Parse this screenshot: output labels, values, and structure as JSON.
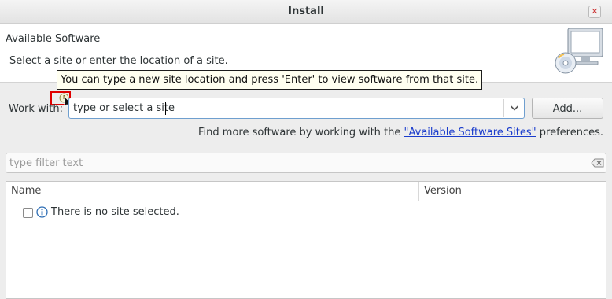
{
  "window": {
    "title": "Install",
    "close_glyph": "✕"
  },
  "header": {
    "title": "Available Software",
    "description": "Select a site or enter the location of a site.",
    "image_icon": "computer-cd-icon"
  },
  "tooltip": {
    "text": "You can type a new site location and press 'Enter' to view software from that site."
  },
  "work_with": {
    "label": "Work with:",
    "value": "type or select a site",
    "dropdown_icon": "chevron-down-icon",
    "add_label": "Add..."
  },
  "find_more": {
    "prefix": "Find more software by working with the ",
    "link": "\"Available Software Sites\"",
    "suffix": " preferences."
  },
  "filter": {
    "placeholder": "type filter text",
    "clear_icon": "clear-text-icon"
  },
  "table": {
    "columns": [
      "Name",
      "Version"
    ],
    "rows": [
      {
        "checked": false,
        "icon": "info-icon",
        "label": "There is no site selected."
      }
    ]
  },
  "colors": {
    "link": "#1a3ccc",
    "focus_border": "#6f9fcf",
    "highlight": "#e00000",
    "tooltip_bg": "#fffff0"
  }
}
